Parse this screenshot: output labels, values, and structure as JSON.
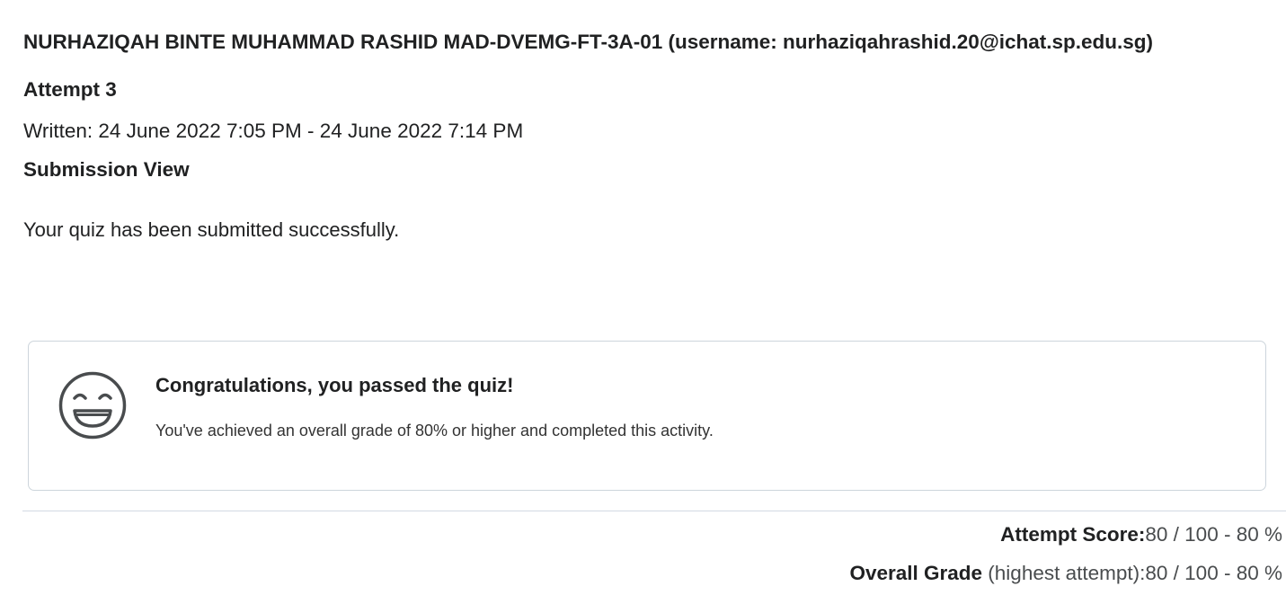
{
  "user": {
    "name": "NURHAZIQAH BINTE MUHAMMAD RASHID MAD-DVEMG-FT-3A-01 (username: nurhaziqahrashid.20@ichat.sp.edu.sg)"
  },
  "attempt": {
    "heading": "Attempt 3",
    "written": "Written: 24 June 2022 7:05 PM - 24 June 2022 7:14 PM"
  },
  "submission": {
    "heading": "Submission View",
    "message": "Your quiz has been submitted successfully."
  },
  "congrats": {
    "icon": "smiley-face-icon",
    "title": "Congratulations, you passed the quiz!",
    "body": "You've achieved an overall grade of 80% or higher and completed this activity."
  },
  "scores": {
    "attempt_label": "Attempt Score:",
    "attempt_value": "80 / 100 - 80 %",
    "overall_label": "Overall Grade",
    "overall_paren": " (highest attempt):",
    "overall_value": "80 / 100 - 80 %"
  },
  "colors": {
    "text": "#202122",
    "card_border": "#cdd5dc",
    "divider": "#d3d9e3"
  }
}
